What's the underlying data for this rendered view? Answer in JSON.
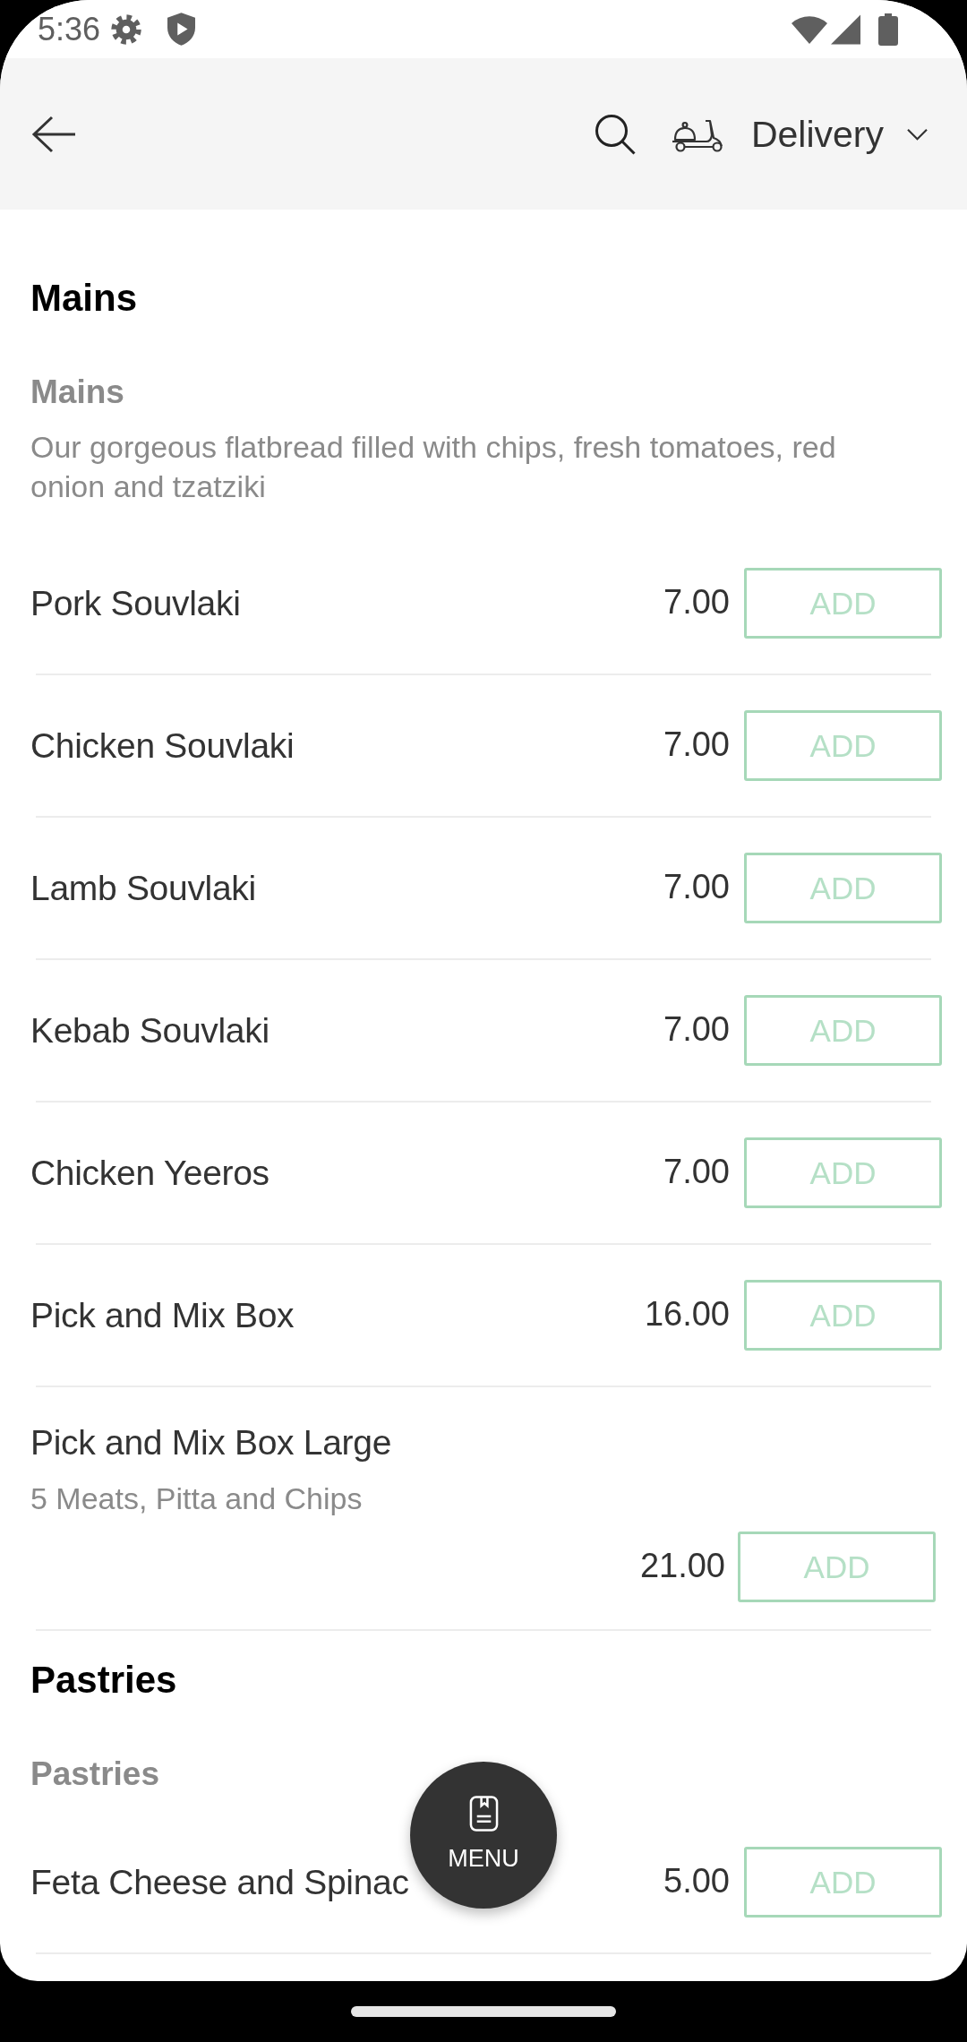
{
  "status_bar": {
    "time": "5:36"
  },
  "header": {
    "delivery_mode": "Delivery"
  },
  "sections": [
    {
      "title": "Mains",
      "categories": [
        {
          "name": "Mains",
          "description": "Our gorgeous flatbread filled with chips, fresh tomatoes, red onion and tzatziki",
          "items": [
            {
              "name": "Pork Souvlaki",
              "price": "7.00",
              "button": "ADD"
            },
            {
              "name": "Chicken Souvlaki",
              "price": "7.00",
              "button": "ADD"
            },
            {
              "name": "Lamb Souvlaki",
              "price": "7.00",
              "button": "ADD"
            },
            {
              "name": "Kebab Souvlaki",
              "price": "7.00",
              "button": "ADD"
            },
            {
              "name": "Chicken Yeeros",
              "price": "7.00",
              "button": "ADD"
            },
            {
              "name": "Pick and Mix Box",
              "price": "16.00",
              "button": "ADD"
            },
            {
              "name": "Pick and Mix Box Large",
              "description": "5 Meats, Pitta and Chips",
              "price": "21.00",
              "button": "ADD"
            }
          ]
        }
      ]
    },
    {
      "title": "Pastries",
      "categories": [
        {
          "name": "Pastries",
          "items": [
            {
              "name": "Feta Cheese and Spinac",
              "price": "5.00",
              "button": "ADD"
            }
          ]
        }
      ]
    }
  ],
  "fab": {
    "label": "MENU"
  }
}
